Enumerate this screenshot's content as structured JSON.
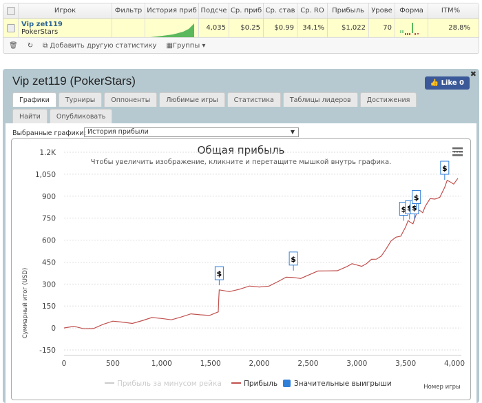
{
  "table": {
    "headers": [
      "Игрок",
      "Фильтр",
      "История приб",
      "Подсче",
      "Ср. приб",
      "Ср. став",
      "Ср. RO",
      "Прибыль",
      "Урове",
      "Форма",
      "ITM%"
    ],
    "row": {
      "player": "Vip zet119",
      "network": "PokerStars",
      "count": "4,035",
      "avg_profit": "$0.25",
      "avg_stake": "$0.99",
      "avg_roi": "34.1%",
      "profit": "$1,022",
      "level": "70",
      "itm": "28.8%"
    },
    "toolbar": {
      "add_stat": "Добавить другую статистику",
      "groups": "Группы"
    }
  },
  "panel": {
    "title": "Vip zet119 (PokerStars)",
    "like": "Like 0",
    "tabs": [
      "Графики",
      "Турниры",
      "Оппоненты",
      "Любимые игры",
      "Статистика",
      "Таблицы лидеров",
      "Достижения",
      "Найти",
      "Опубликовать"
    ],
    "select_label": "Выбранные графики:",
    "select_value": "История прибыли"
  },
  "chart_data": {
    "type": "line",
    "title": "Общая прибыль",
    "subtitle": "Чтобы увеличить изображение, кликните и перетащите мышкой внутрь графика.",
    "ylabel": "Суммарный итог (USD)",
    "xlabel": "Номер игры",
    "ylim": [
      -150,
      1200
    ],
    "xlim": [
      0,
      4000
    ],
    "yticks": [
      "-150",
      "0",
      "150",
      "300",
      "450",
      "600",
      "750",
      "900",
      "1,050",
      "1.2K"
    ],
    "ytick_values": [
      -150,
      0,
      150,
      300,
      450,
      600,
      750,
      900,
      1050,
      1200
    ],
    "xticks": [
      "0",
      "500",
      "1,000",
      "1,500",
      "2,000",
      "2,500",
      "3,000",
      "3,500",
      "4,000"
    ],
    "xtick_values": [
      0,
      500,
      1000,
      1500,
      2000,
      2500,
      3000,
      3500,
      4000
    ],
    "legend": [
      "Прибыль за минусом рейка",
      "Прибыль",
      "Значительные выигрыши"
    ],
    "series": [
      {
        "name": "Прибыль",
        "color": "#c0504d",
        "x": [
          0,
          200,
          400,
          600,
          800,
          1000,
          1200,
          1400,
          1580,
          1590,
          1800,
          2000,
          2200,
          2350,
          2500,
          2700,
          2900,
          3000,
          3100,
          3200,
          3300,
          3400,
          3500,
          3550,
          3600,
          3650,
          3700,
          3800,
          3900,
          3950,
          4035
        ],
        "y": [
          0,
          -5,
          25,
          40,
          50,
          65,
          75,
          90,
          110,
          260,
          265,
          280,
          320,
          345,
          360,
          390,
          420,
          430,
          440,
          470,
          540,
          620,
          690,
          720,
          760,
          800,
          830,
          880,
          960,
          1000,
          1022
        ]
      }
    ],
    "big_wins": {
      "label": "$",
      "x": [
        1590,
        2350,
        3480,
        3540,
        3590,
        3610,
        3900
      ],
      "y": [
        320,
        420,
        760,
        770,
        770,
        840,
        1040
      ]
    }
  }
}
